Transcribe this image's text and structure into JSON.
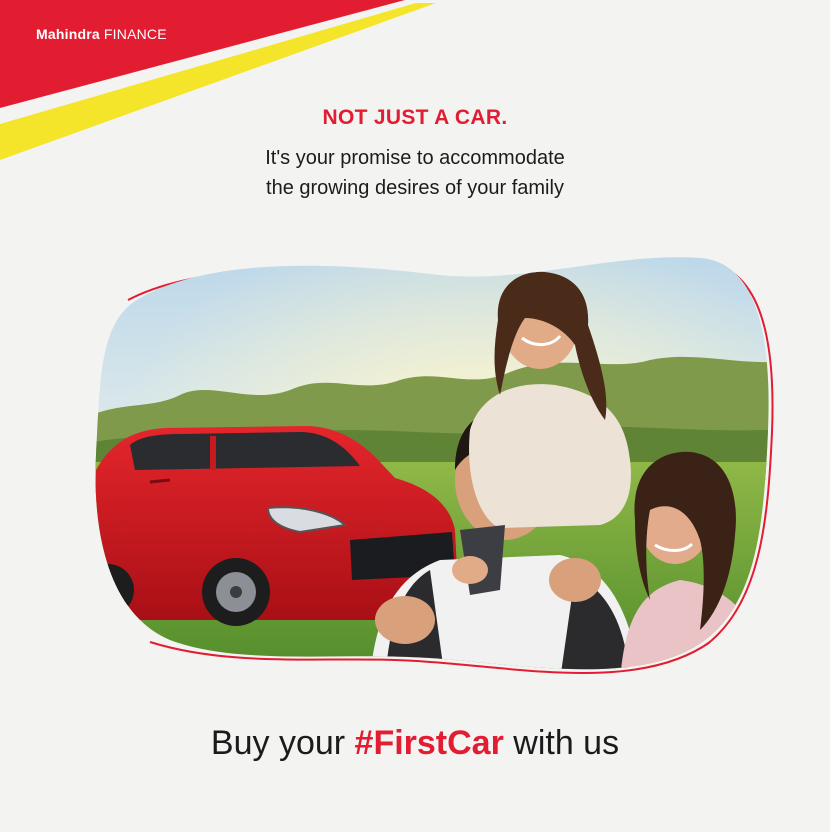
{
  "brand": {
    "name_bold": "Mahindra",
    "name_regular": "FINANCE",
    "colors": {
      "red": "#e21d32",
      "yellow": "#f5e52a"
    }
  },
  "headline": "NOT JUST A CAR.",
  "subtext": {
    "line1": "It's your promise to accommodate",
    "line2": "the growing desires of your family"
  },
  "photo": {
    "subject": "family-with-red-car",
    "icon": "car-family-photo"
  },
  "tagline": {
    "prefix": "Buy your ",
    "hashtag": "#FirstCar",
    "suffix": " with us"
  }
}
